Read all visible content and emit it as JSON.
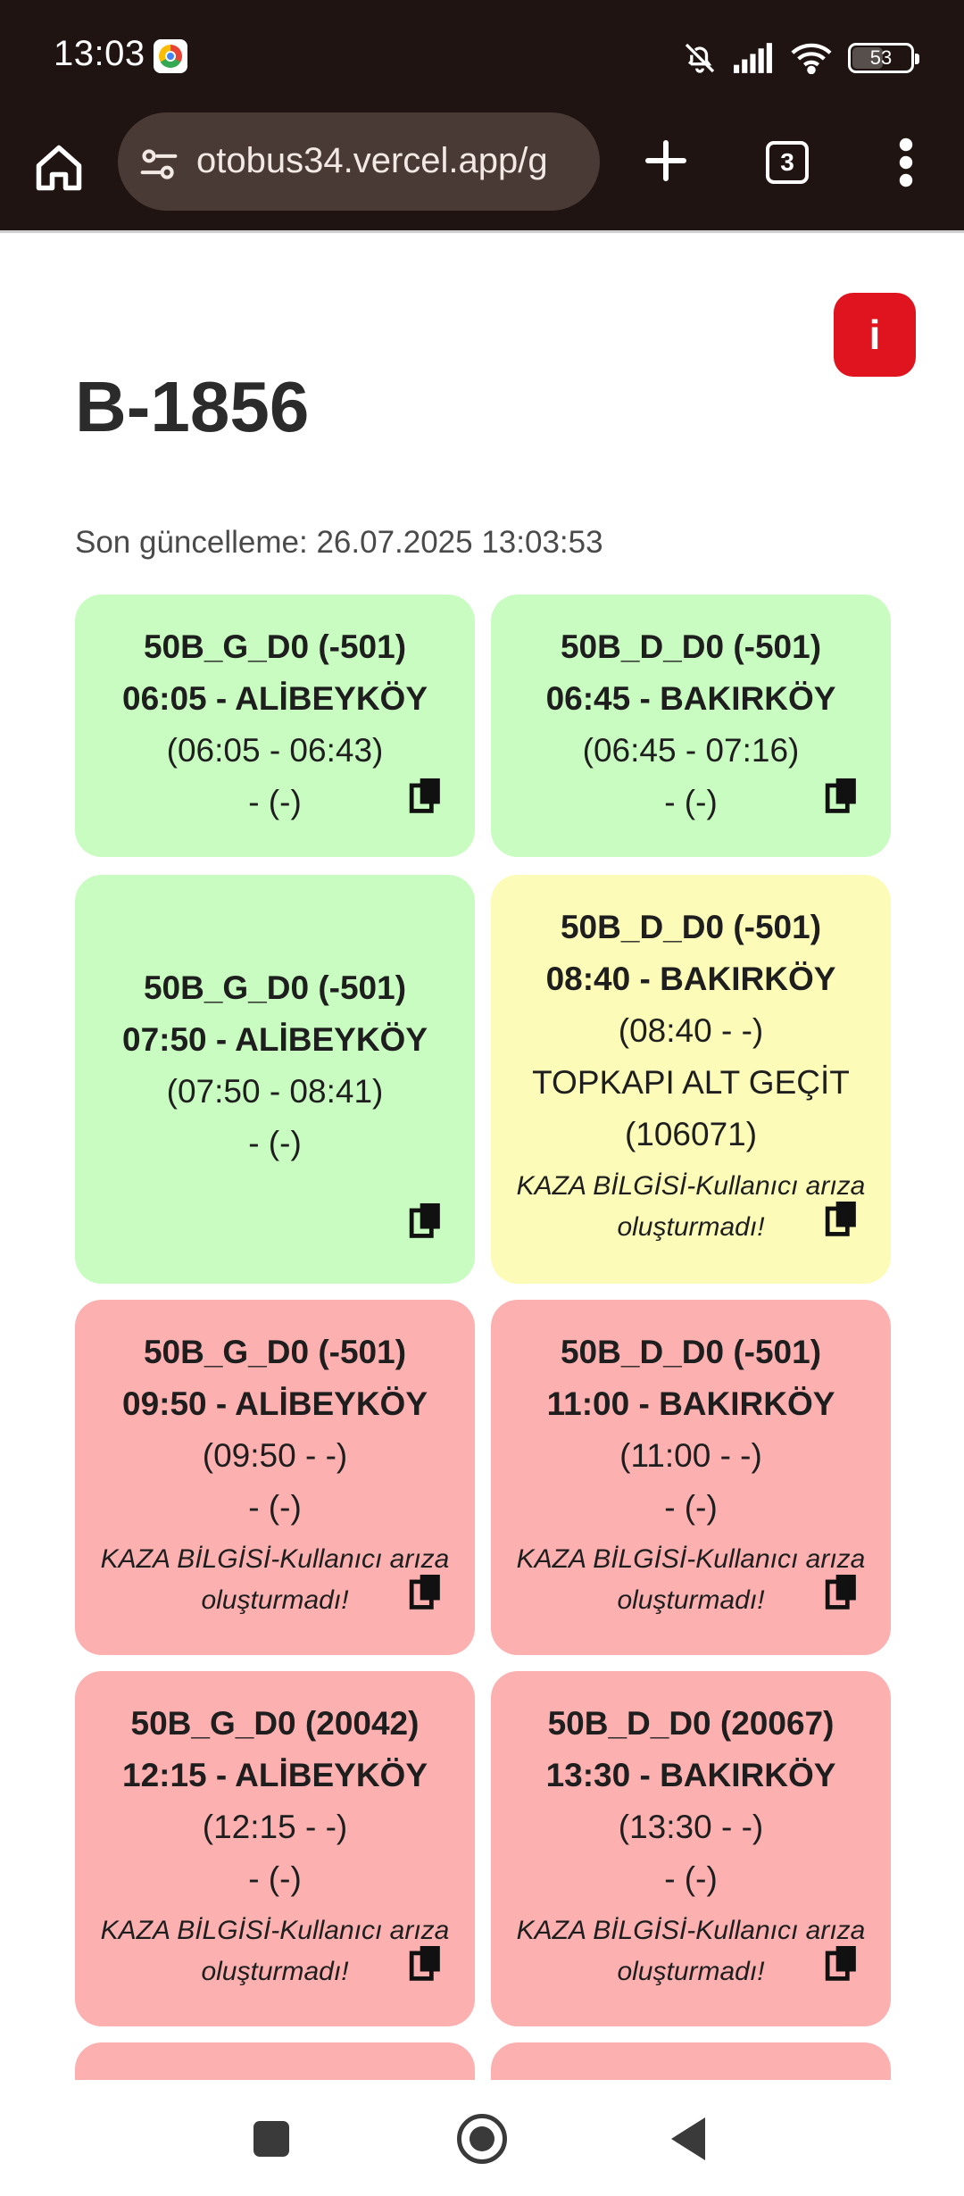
{
  "status_bar": {
    "time": "13:03",
    "battery": "53",
    "battery_level": 0.53,
    "icons": [
      "chrome-icon",
      "bell-off-icon",
      "signal-icon",
      "wifi-icon",
      "battery-icon"
    ]
  },
  "browser": {
    "url": "otobus34.vercel.app/g",
    "tab_count": "3",
    "icons": [
      "home-icon",
      "site-settings-icon",
      "new-tab-plus-icon",
      "tab-switcher-icon",
      "more-menu-icon"
    ]
  },
  "page": {
    "info_label": "i",
    "title": "B-1856",
    "last_updated": "Son güncelleme: 26.07.2025 13:03:53"
  },
  "trips": [
    {
      "route": "50B_G_D0 (-501)",
      "departure": "06:05 - ALİBEYKÖY",
      "times": "(06:05 - 06:43)",
      "stop": "- (-)",
      "note": "",
      "status": "green"
    },
    {
      "route": "50B_D_D0 (-501)",
      "departure": "06:45 - BAKIRKÖY",
      "times": "(06:45 - 07:16)",
      "stop": "- (-)",
      "note": "",
      "status": "green"
    },
    {
      "route": "50B_G_D0 (-501)",
      "departure": "07:50 - ALİBEYKÖY",
      "times": "(07:50 - 08:41)",
      "stop": "- (-)",
      "note": "",
      "status": "green"
    },
    {
      "route": "50B_D_D0 (-501)",
      "departure": "08:40 - BAKIRKÖY",
      "times": "(08:40 - -)",
      "stop": "TOPKAPI ALT GEÇİT",
      "stop_code": "(106071)",
      "note": "KAZA BİLGİSİ-Kullanıcı arıza oluşturmadı!",
      "status": "yellow"
    },
    {
      "route": "50B_G_D0 (-501)",
      "departure": "09:50 - ALİBEYKÖY",
      "times": "(09:50 - -)",
      "stop": "- (-)",
      "note": "KAZA BİLGİSİ-Kullanıcı arıza oluşturmadı!",
      "status": "red"
    },
    {
      "route": "50B_D_D0 (-501)",
      "departure": "11:00 - BAKIRKÖY",
      "times": "(11:00 - -)",
      "stop": "- (-)",
      "note": "KAZA BİLGİSİ-Kullanıcı arıza oluşturmadı!",
      "status": "red"
    },
    {
      "route": "50B_G_D0 (20042)",
      "departure": "12:15 - ALİBEYKÖY",
      "times": "(12:15 - -)",
      "stop": "- (-)",
      "note": "KAZA BİLGİSİ-Kullanıcı arıza oluşturmadı!",
      "status": "red"
    },
    {
      "route": "50B_D_D0 (20067)",
      "departure": "13:30 - BAKIRKÖY",
      "times": "(13:30 - -)",
      "stop": "- (-)",
      "note": "KAZA BİLGİSİ-Kullanıcı arıza oluşturmadı!",
      "status": "red"
    }
  ],
  "colors": {
    "green": "#c8fcc0",
    "yellow": "#fcfcb8",
    "red": "#fcb0b0",
    "info_button": "#e0141e",
    "browser_bar": "#1f1411"
  },
  "nav_bar": {
    "icons": [
      "recents-square-icon",
      "home-circle-icon",
      "back-triangle-icon"
    ]
  }
}
